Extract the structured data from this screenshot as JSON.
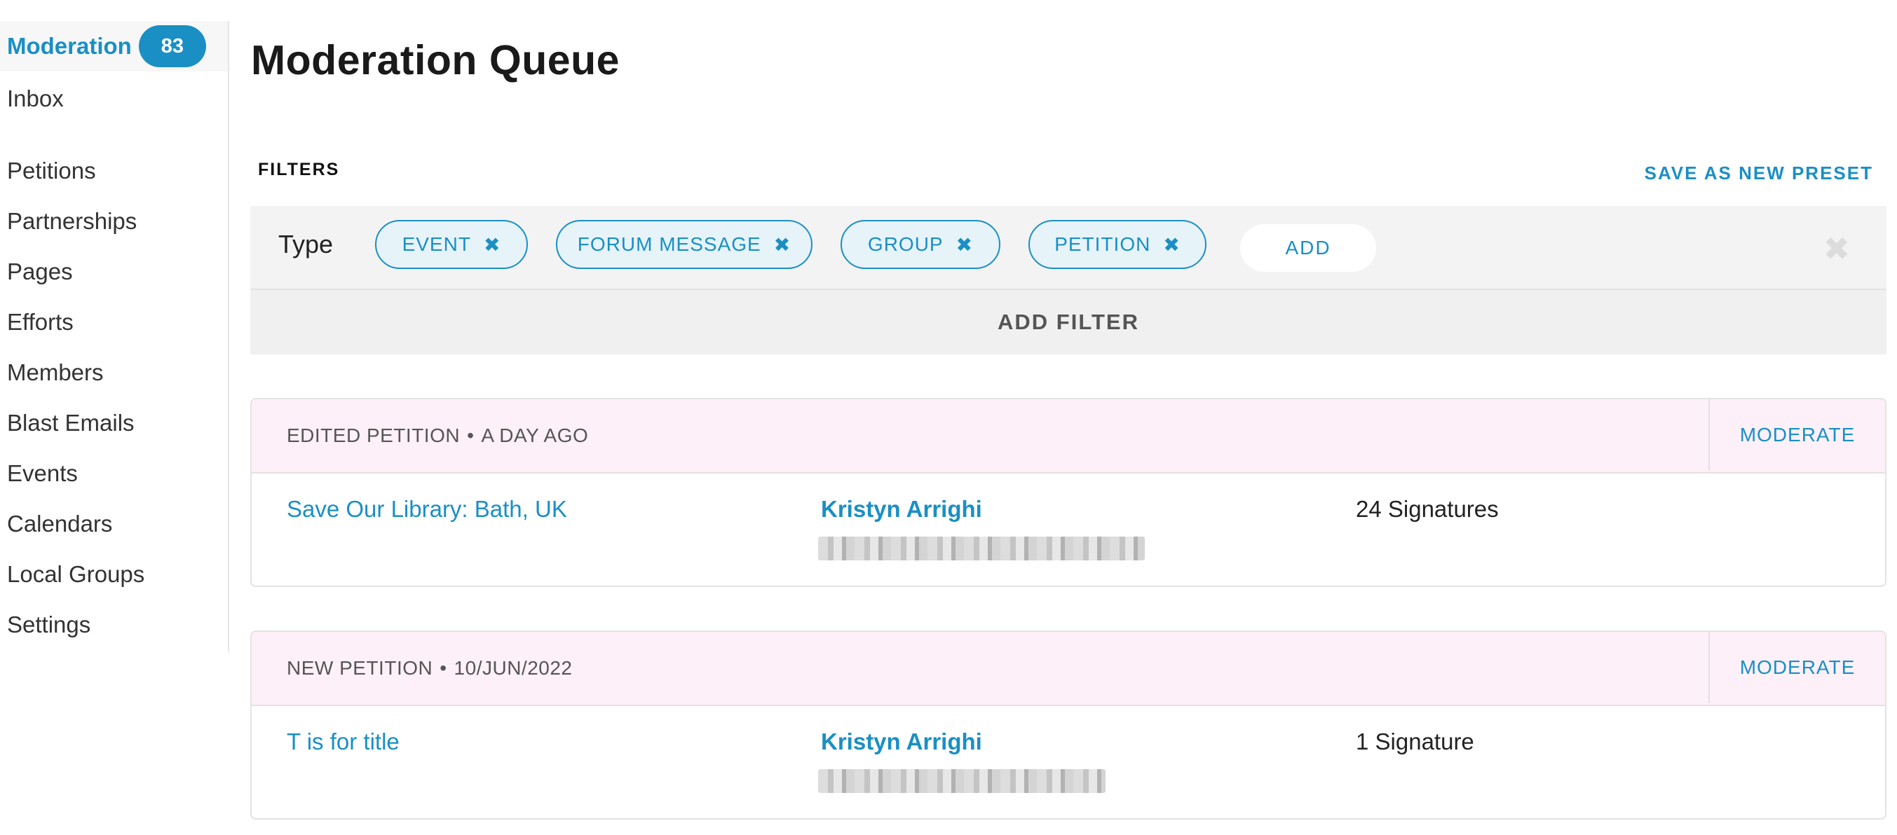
{
  "sidebar": {
    "active": {
      "label": "Moderation",
      "badge": "83"
    },
    "items": [
      {
        "label": "Inbox"
      },
      {
        "label": "Petitions"
      },
      {
        "label": "Partnerships"
      },
      {
        "label": "Pages"
      },
      {
        "label": "Efforts"
      },
      {
        "label": "Members"
      },
      {
        "label": "Blast Emails"
      },
      {
        "label": "Events"
      },
      {
        "label": "Calendars"
      },
      {
        "label": "Local Groups"
      },
      {
        "label": "Settings"
      }
    ]
  },
  "page": {
    "title": "Moderation Queue"
  },
  "filters": {
    "label": "FILTERS",
    "save_preset": "SAVE AS NEW PRESET",
    "type_label": "Type",
    "chips": [
      {
        "label": "EVENT"
      },
      {
        "label": "FORUM MESSAGE"
      },
      {
        "label": "GROUP"
      },
      {
        "label": "PETITION"
      }
    ],
    "chip_remove_glyph": "✖",
    "add_label": "ADD",
    "clear_glyph": "✖",
    "add_filter_label": "ADD FILTER"
  },
  "queue": [
    {
      "kind": "EDITED PETITION",
      "when": "A DAY AGO",
      "moderate_label": "MODERATE",
      "title": "Save Our Library: Bath, UK",
      "author": "Kristyn Arrighi",
      "signatures": "24 Signatures"
    },
    {
      "kind": "NEW PETITION",
      "when": "10/JUN/2022",
      "moderate_label": "MODERATE",
      "title": "T is for title",
      "author": "Kristyn Arrighi",
      "signatures": "1 Signature"
    }
  ],
  "colors": {
    "accent": "#1a8fc4",
    "card_header": "#fdf0f8",
    "filter_bg": "#f3f3f3"
  }
}
